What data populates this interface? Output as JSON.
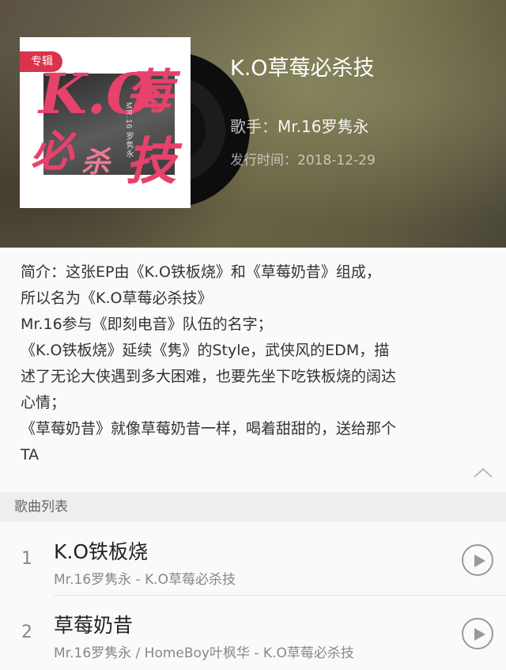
{
  "album": {
    "tag": "专辑",
    "title": "K.O草莓必杀技",
    "artist_label": "歌手：",
    "artist": "Mr.16罗隽永",
    "release_label": "发行时间：",
    "release_date": "2018-12-29",
    "cover_art_letters": [
      "K.O",
      "莓",
      "必",
      "技",
      "杀"
    ],
    "cover_art_caption": "MR.16 罗隽永"
  },
  "intro": {
    "lines": [
      "简介：这张EP由《K.O铁板烧》和《草莓奶昔》组成，",
      "所以名为《K.O草莓必杀技》",
      "Mr.16参与《即刻电音》队伍的名字；",
      "《K.O铁板烧》延续《隽》的Style，武侠风的EDM，描",
      "述了无论大侠遇到多大困难，也要先坐下吃铁板烧的阔达",
      "心情；",
      "《草莓奶昔》就像草莓奶昔一样，喝着甜甜的，送给那个",
      "TA"
    ]
  },
  "song_list": {
    "header": "歌曲列表",
    "songs": [
      {
        "index": "1",
        "title": "K.O铁板烧",
        "meta": "Mr.16罗隽永 - K.O草莓必杀技"
      },
      {
        "index": "2",
        "title": "草莓奶昔",
        "meta": "Mr.16罗隽永 / HomeBoy叶枫华 - K.O草莓必杀技"
      }
    ]
  },
  "colors": {
    "tag_bg": "#d9344c",
    "cover_text": "#e6426b",
    "section_bg": "#eeeeee"
  }
}
